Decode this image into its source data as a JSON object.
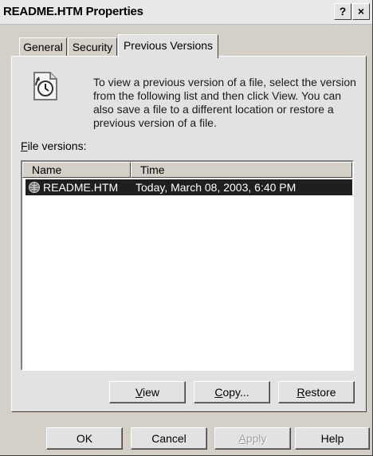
{
  "window": {
    "title": "README.HTM Properties",
    "help_button": "?",
    "close_button": "×"
  },
  "tabs": [
    {
      "label": "General",
      "active": false
    },
    {
      "label": "Security",
      "active": false
    },
    {
      "label": "Previous Versions",
      "active": true
    }
  ],
  "panel": {
    "icon": "previous-versions-clock-icon",
    "description": "To view a previous version of a file, select the version from the following list and then click View.  You can also save a file to a different location or restore a previous version of a file.",
    "file_versions_label_accel": "F",
    "file_versions_label_rest": "ile versions:"
  },
  "listview": {
    "columns": [
      "Name",
      "Time"
    ],
    "rows": [
      {
        "icon": "htm-file-icon",
        "name": "README.HTM",
        "time": "Today, March 08, 2003, 6:40 PM",
        "selected": true
      }
    ]
  },
  "panel_buttons": {
    "view": {
      "accel": "V",
      "rest": "iew"
    },
    "copy": {
      "accel": "C",
      "rest": "opy..."
    },
    "restore": {
      "accel": "R",
      "rest": "estore"
    }
  },
  "dialog_buttons": {
    "ok": "OK",
    "cancel": "Cancel",
    "apply_accel": "A",
    "apply_rest": "pply",
    "help": "Help"
  },
  "colors": {
    "selection": "#1f1f1f",
    "face": "#d4d0c8",
    "panel": "#e2e2e2"
  }
}
